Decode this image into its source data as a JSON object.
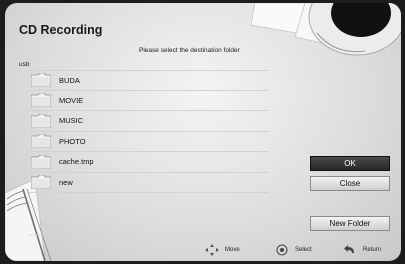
{
  "dialog": {
    "title": "CD Recording",
    "subtitle": "Please select the destination folder",
    "path": "usb"
  },
  "folders": [
    {
      "name": "BUDA",
      "icon": "folder-icon"
    },
    {
      "name": "MOVIE",
      "icon": "folder-icon"
    },
    {
      "name": "MUSIC",
      "icon": "folder-icon"
    },
    {
      "name": "PHOTO",
      "icon": "folder-icon"
    },
    {
      "name": "cache.tmp",
      "icon": "folder-icon"
    },
    {
      "name": "new",
      "icon": "folder-icon"
    }
  ],
  "buttons": {
    "ok": "OK",
    "close": "Close",
    "new_folder": "New Folder"
  },
  "hints": {
    "move": "Move",
    "select": "Select",
    "return": "Return"
  },
  "colors": {
    "active_button": "#2f2f2f",
    "panel": "#e6e6e6"
  }
}
